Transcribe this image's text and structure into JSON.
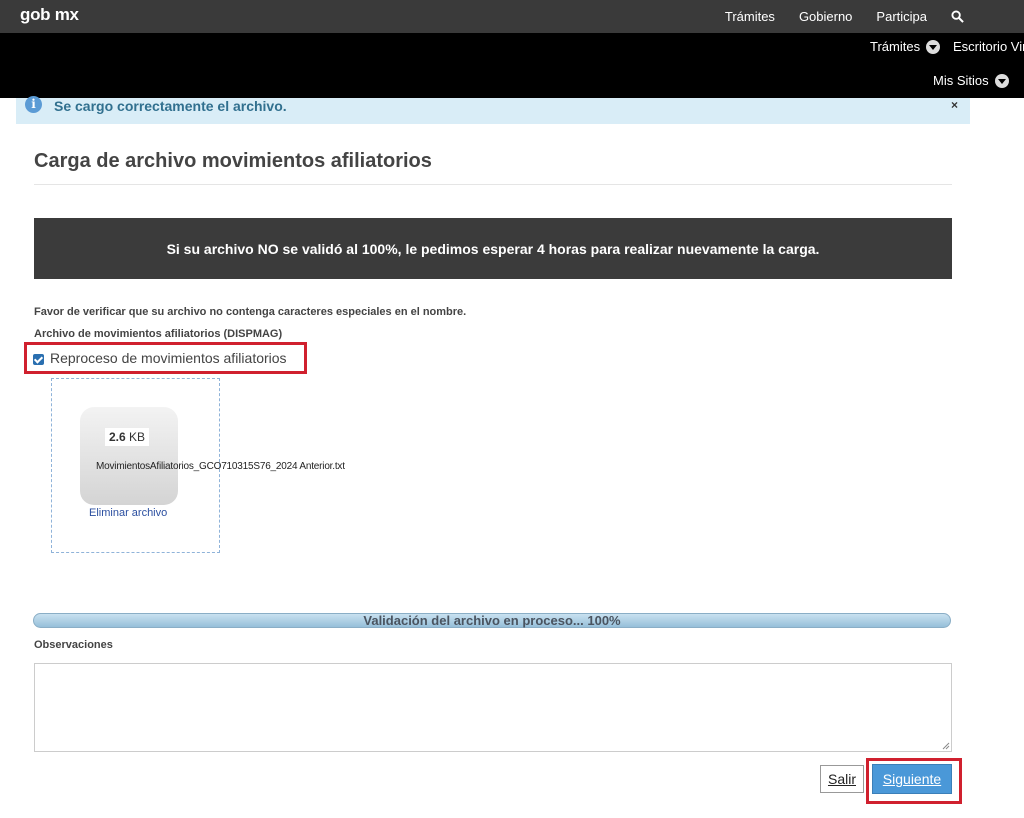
{
  "header": {
    "brand_a": "gob",
    "brand_b": "mx",
    "nav": [
      "Trámites",
      "Gobierno",
      "Participa"
    ],
    "search_icon": "search-icon"
  },
  "subnav": {
    "tramites": "Trámites",
    "escritorio": "Escritorio Vir",
    "mis_sitios": "Mis Sitios"
  },
  "alert": {
    "message": "Se cargo correctamente el archivo.",
    "close": "×",
    "icon": "i"
  },
  "page": {
    "title": "Carga de archivo movimientos afiliatorios",
    "warning": "Si su archivo NO se validó al 100%, le pedimos esperar 4 horas para realizar nuevamente la carga.",
    "note": "Favor de verificar que su archivo no contenga caracteres especiales en el nombre.",
    "field_label": "Archivo de movimientos afiliatorios (DISPMAG)",
    "reprocess_label": "Reproceso de movimientos afiliatorios",
    "reprocess_checked": true
  },
  "file": {
    "size_value": "2.6",
    "size_unit": "KB",
    "name": "MovimientosAfiliatorios_GCO710315S76_2024 Anterior.txt",
    "remove": "Eliminar archivo"
  },
  "progress": {
    "label": "Validación del archivo en proceso... 100%",
    "percent": 100
  },
  "observations": {
    "label": "Observaciones",
    "value": ""
  },
  "buttons": {
    "exit": "Salir",
    "next": "Siguiente"
  },
  "colors": {
    "topbar": "#3a3a3a",
    "subbar": "#000000",
    "alert_bg": "#d9edf7",
    "highlight": "#d0202e",
    "primary": "#4a98d8"
  }
}
